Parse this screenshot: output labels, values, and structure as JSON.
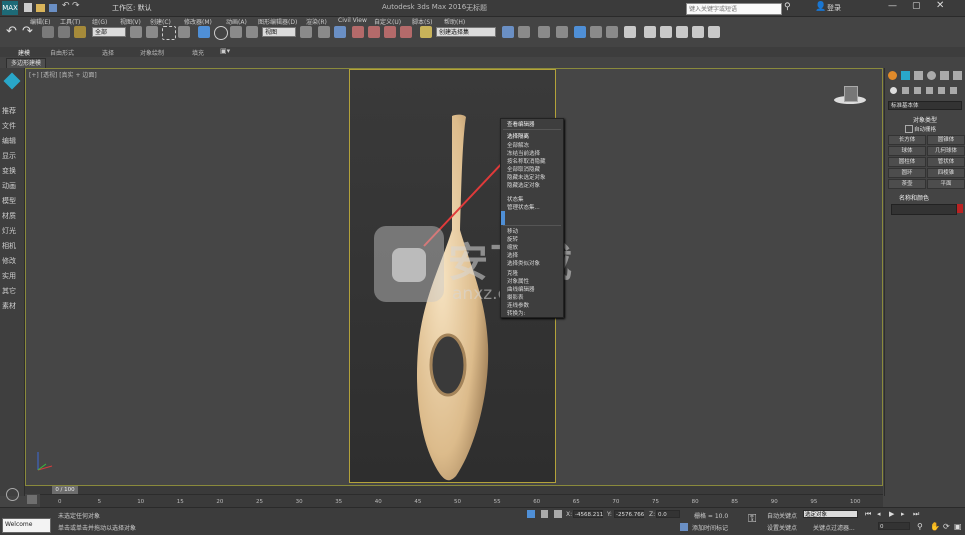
{
  "titlebar": {
    "title": "Autodesk 3ds Max 2016",
    "subtitle": "无标题",
    "workspace": "工作区: 默认",
    "menus": [
      "编辑(E)",
      "工具(T)",
      "组(G)",
      "视图(V)",
      "创建(C)",
      "修改器(M)",
      "动画(A)",
      "图形编辑器(D)",
      "渲染(R)",
      "Civil View",
      "自定义(U)",
      "脚本(S)",
      "帮助(H)"
    ],
    "search_placeholder": "键入关键字或短语",
    "login": "登录"
  },
  "toolbar": {
    "selection_filter": "全部",
    "view_combo": "视图",
    "named_selection": "创建选择集"
  },
  "ribbon": {
    "tabs": [
      "建模",
      "自由形式",
      "选择",
      "对象绘制",
      "填充"
    ],
    "subtab": "多边形建模"
  },
  "sidebar": {
    "items": [
      "推荐",
      "文件",
      "编辑",
      "显示",
      "变换",
      "动画",
      "模型",
      "材质",
      "灯光",
      "相机",
      "修改",
      "实用",
      "其它",
      "素材"
    ]
  },
  "viewport": {
    "label": "[+] [透视] [真实 + 边面]"
  },
  "context_menu": {
    "header": "查看编辑器",
    "items": [
      "选择隔离",
      "全部解冻",
      "冻结当前选择",
      "按名称取消隐藏",
      "全部取消隐藏",
      "隐藏未选定对象",
      "隐藏选定对象",
      "状态集",
      "管理状态集...",
      "移动",
      "旋转",
      "缩放",
      "选择",
      "选择类似对象",
      "克隆",
      "对象属性",
      "曲线编辑器",
      "摄影表",
      "连线参数",
      "转换为:"
    ]
  },
  "watermark": {
    "cn": "安下载",
    "en": "anxz.com"
  },
  "right_panel": {
    "dropdown": "标准基本体",
    "section_title": "对象类型",
    "autogrid": "自动栅格",
    "buttons": [
      "长方体",
      "圆锥体",
      "球体",
      "几何球体",
      "圆柱体",
      "管状体",
      "圆环",
      "四棱锥",
      "茶壶",
      "平面"
    ],
    "name_section": "名称和颜色"
  },
  "timeline": {
    "position": "0 / 100",
    "ticks": [
      "0",
      "5",
      "10",
      "15",
      "20",
      "25",
      "30",
      "35",
      "40",
      "45",
      "50",
      "55",
      "60",
      "65",
      "70",
      "75",
      "80",
      "85",
      "90",
      "95",
      "100"
    ]
  },
  "status": {
    "script": "Welcome",
    "line1": "未选定任何对象",
    "line2": "单击或单击并拖动以选择对象",
    "x_value": "-4568.211",
    "y_value": "-2576.766",
    "z_value": "0.0",
    "grid": "栅格 = 10.0",
    "add_time_tag": "添加时间标记",
    "auto_key": "自动关键点",
    "selected": "选定对象",
    "set_key": "设置关键点",
    "key_filter": "关键点过滤器...",
    "frame": "0"
  },
  "colors": {
    "accent": "#29a7c9",
    "viewport_border": "#b3a23a",
    "arrow": "#e03a3a",
    "vase": "#e6cba2"
  }
}
